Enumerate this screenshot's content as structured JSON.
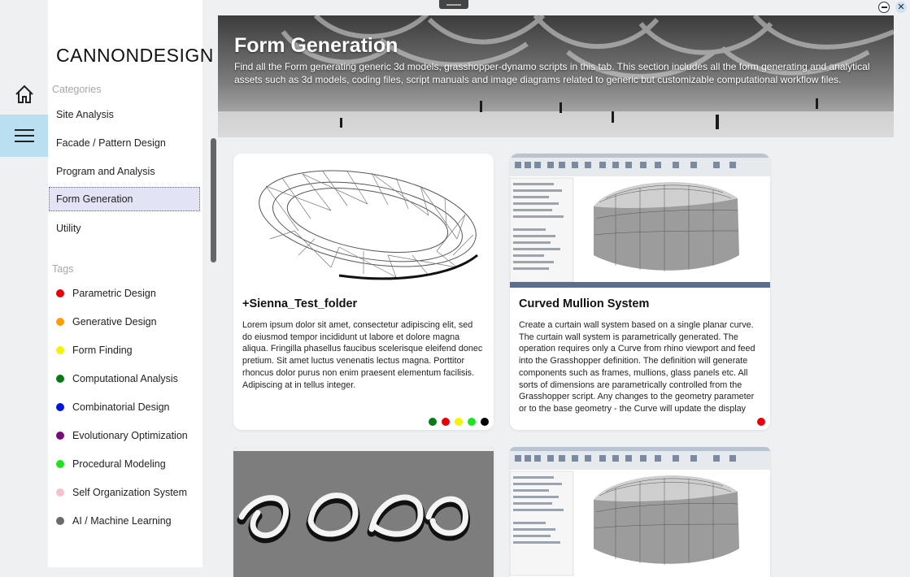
{
  "brand": "CANNONDESIGN",
  "categories_label": "Categories",
  "categories": [
    {
      "label": "Site Analysis",
      "active": false
    },
    {
      "label": "Facade / Pattern Design",
      "active": false
    },
    {
      "label": "Program and Analysis",
      "active": false
    },
    {
      "label": "Form Generation",
      "active": true
    },
    {
      "label": "Utility",
      "active": false
    }
  ],
  "tags_label": "Tags",
  "tags": [
    {
      "label": "Parametric Design",
      "color": "#e8000b"
    },
    {
      "label": "Generative Design",
      "color": "#ff9e00"
    },
    {
      "label": "Form Finding",
      "color": "#f4f400"
    },
    {
      "label": "Computational Analysis",
      "color": "#0b7a16"
    },
    {
      "label": "Combinatorial Design",
      "color": "#0016e0"
    },
    {
      "label": "Evolutionary Optimization",
      "color": "#7b0a7d"
    },
    {
      "label": "Procedural Modeling",
      "color": "#1de41d"
    },
    {
      "label": "Self Organization System",
      "color": "#f8c1cc"
    },
    {
      "label": "AI / Machine Learning",
      "color": "#6b6b6b"
    }
  ],
  "hero": {
    "title": "Form Generation",
    "description": "Find all the Form generating generic 3d models, grasshopper-dynamo scripts in this tab. This section includes all the form generating and analytical assets such as 3d models, coding files, script manuals and image diagrams related to generic but customizable computational workflow files."
  },
  "cards": [
    {
      "title": "+Sienna_Test_folder",
      "description": "Lorem ipsum dolor sit amet, consectetur adipiscing elit, sed do eiusmod tempor incididunt ut labore et dolore magna aliqua. Fringilla phasellus faucibus scelerisque eleifend donec pretium. Sit amet luctus venenatis lectus magna. Porttitor rhoncus dolor purus non enim praesent elementum facilisis. Adipiscing at in tellus integer.",
      "thumb": "stadium-wireframe",
      "tag_colors": [
        "#0b7a16",
        "#e8000b",
        "#f4f400",
        "#1de41d",
        "#000000"
      ]
    },
    {
      "title": "Curved Mullion System",
      "description": "Create a curtain wall system based on a single planar curve. The curtain wall system is parametrically generated. The operation requires only a Curve from rhino viewport and feed into the Grasshopper definition. The definition will generate components such as frames, mullions, glass panels etc. All sorts of dimensions are parametrically controlled from the Grasshopper script. Any changes to the geometry parameter or to the base geometry - the Curve will update the display",
      "thumb": "revit-shell-screenshot",
      "tag_colors": [
        "#e8000b"
      ]
    },
    {
      "title": "",
      "description": "",
      "thumb": "ribbon-form",
      "tag_colors": []
    },
    {
      "title": "",
      "description": "",
      "thumb": "revit-shell-screenshot",
      "tag_colors": []
    }
  ]
}
